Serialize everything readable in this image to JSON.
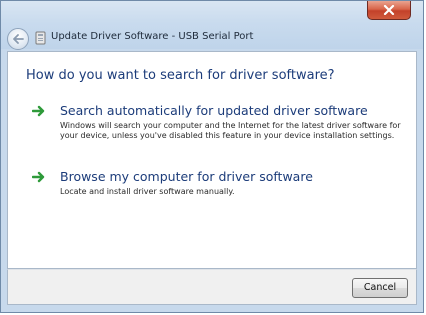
{
  "window": {
    "title": "Update Driver Software - USB Serial Port",
    "close_icon": "close-icon",
    "back_icon": "back-arrow-icon"
  },
  "main": {
    "heading": "How do you want to search for driver software?",
    "options": [
      {
        "title": "Search automatically for updated driver software",
        "description": "Windows will search your computer and the Internet for the latest driver software for your device, unless you've disabled this feature in your device installation settings.",
        "icon": "green-arrow-icon"
      },
      {
        "title": "Browse my computer for driver software",
        "description": "Locate and install driver software manually.",
        "icon": "green-arrow-icon"
      }
    ]
  },
  "footer": {
    "cancel_label": "Cancel"
  },
  "colors": {
    "accent_text": "#1c3c7a",
    "arrow_green": "#2e9a3a",
    "close_red": "#c3412a"
  }
}
